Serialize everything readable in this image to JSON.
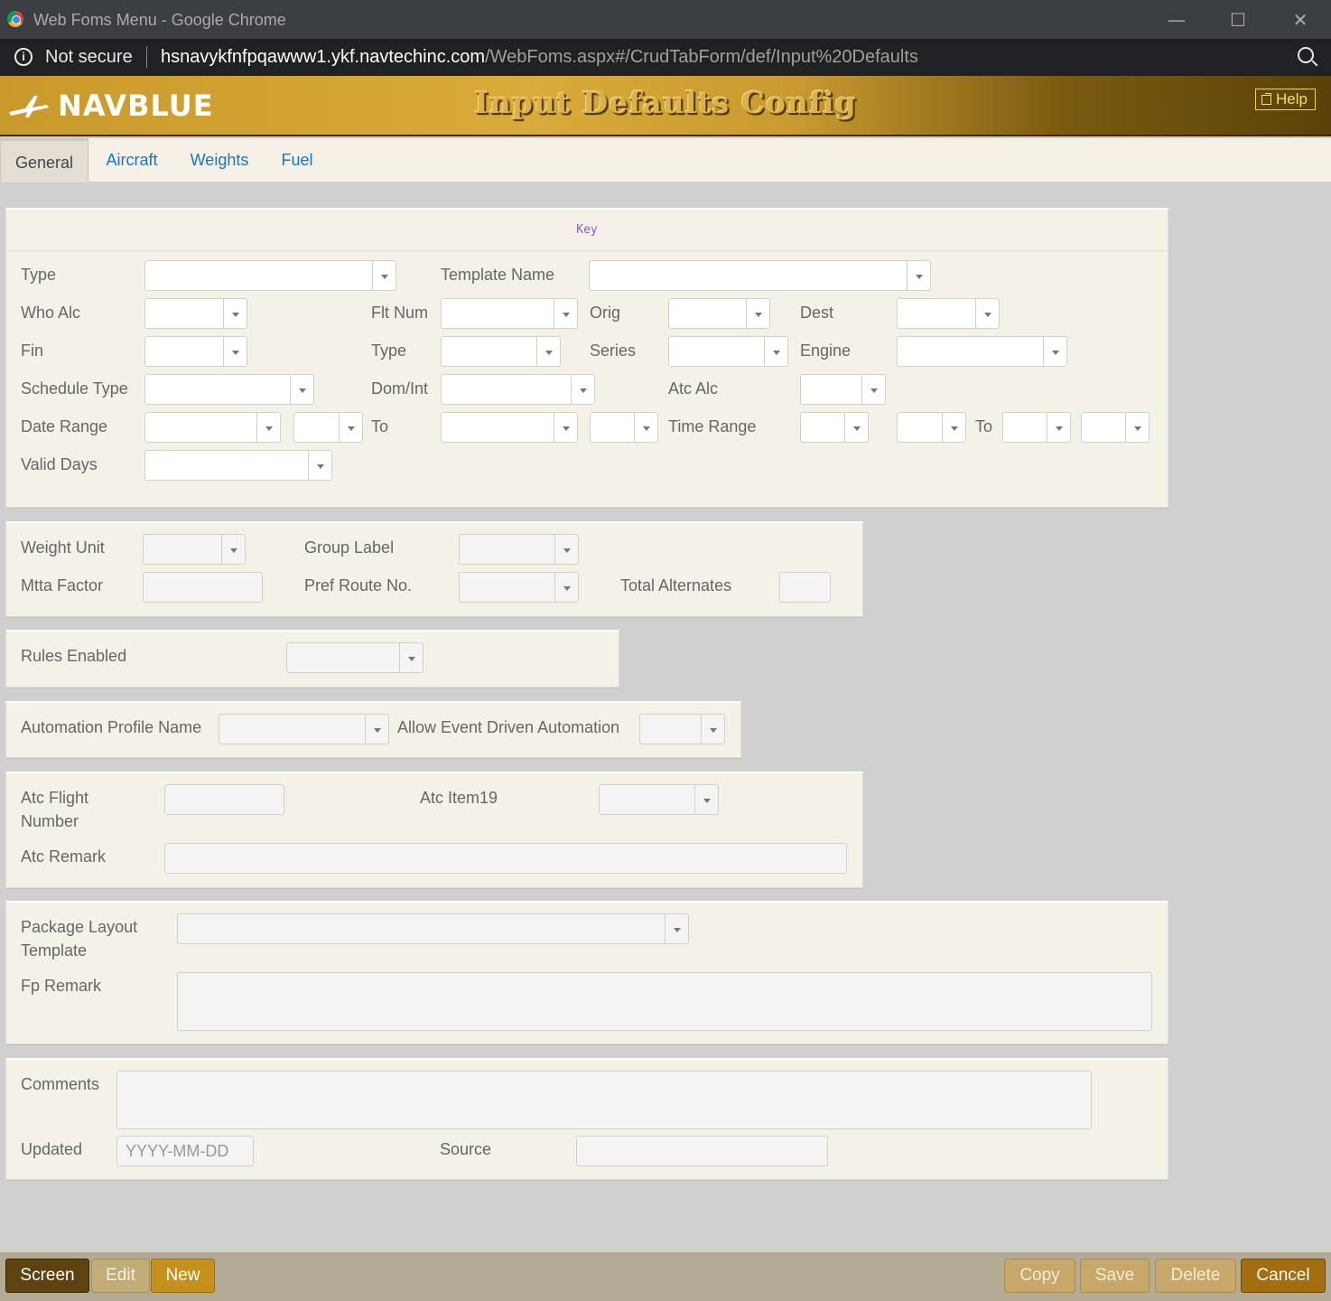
{
  "window": {
    "title": "Web Foms Menu - Google Chrome"
  },
  "address": {
    "security": "Not secure",
    "host": "hsnavykfnfpqawww1.ykf.navtechinc.com",
    "path": "/WebFoms.aspx#/CrudTabForm/def/Input%20Defaults"
  },
  "header": {
    "brand": "NAVBLUE",
    "title": "Input Defaults Config",
    "help": "Help"
  },
  "tabs": [
    {
      "label": "General"
    },
    {
      "label": "Aircraft"
    },
    {
      "label": "Weights"
    },
    {
      "label": "Fuel"
    }
  ],
  "key": {
    "heading": "Key",
    "labels": {
      "type": "Type",
      "template_name": "Template Name",
      "who_alc": "Who Alc",
      "flt_num": "Flt Num",
      "orig": "Orig",
      "dest": "Dest",
      "fin": "Fin",
      "type2": "Type",
      "series": "Series",
      "engine": "Engine",
      "schedule_type": "Schedule Type",
      "dom_int": "Dom/Int",
      "atc_alc": "Atc Alc",
      "date_range": "Date Range",
      "to1": "To",
      "time_range": "Time Range",
      "to2": "To",
      "valid_days": "Valid Days"
    }
  },
  "weights": {
    "weight_unit": "Weight Unit",
    "group_label": "Group Label",
    "mtta_factor": "Mtta Factor",
    "pref_route": "Pref Route No.",
    "total_alternates": "Total Alternates"
  },
  "rules": {
    "rules_enabled": "Rules Enabled"
  },
  "automation": {
    "profile_name": "Automation Profile Name",
    "event_driven": "Allow Event Driven Automation"
  },
  "atc": {
    "flight_number": "Atc Flight Number",
    "item19": "Atc Item19",
    "remark": "Atc Remark"
  },
  "package": {
    "layout_template": "Package Layout Template",
    "fp_remark": "Fp Remark"
  },
  "comments": {
    "comments": "Comments",
    "updated": "Updated",
    "updated_placeholder": "YYYY-MM-DD",
    "source": "Source"
  },
  "footer": {
    "screen": "Screen",
    "edit": "Edit",
    "new": "New",
    "copy": "Copy",
    "save": "Save",
    "delete": "Delete",
    "cancel": "Cancel"
  },
  "colors": {
    "header_gold": "#c99a2b",
    "tab_link": "#1a73c8",
    "footer_dark": "#5e4310"
  }
}
